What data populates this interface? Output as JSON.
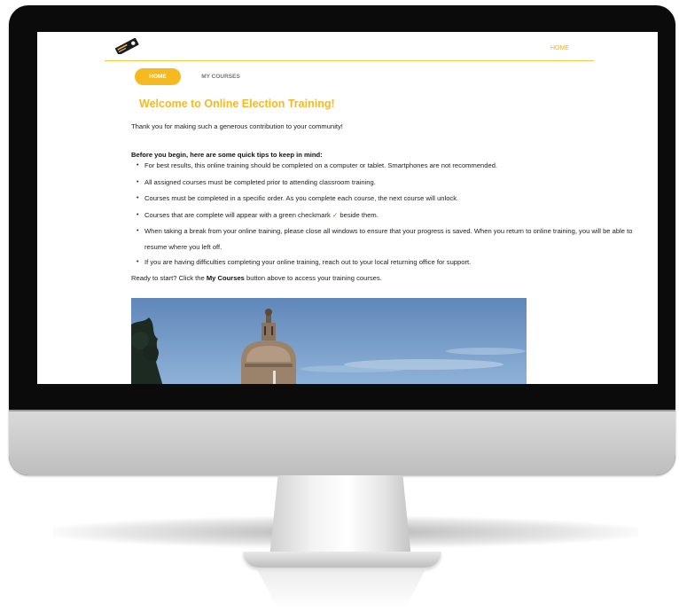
{
  "nav": {
    "home_label": "HOME"
  },
  "tabs": {
    "home_label": "HOME",
    "courses_label": "MY COURSES"
  },
  "welcome": {
    "title": "Welcome to Online Election Training!",
    "intro": "Thank you for making such a generous contribution to your community!"
  },
  "tips": {
    "heading": "Before you begin, here are some quick tips to keep in mind:",
    "items": [
      "For best results, this online training should be completed on a computer or tablet. Smartphones are not recommended.",
      "All assigned courses must be completed prior to attending classroom training.",
      "Courses must be completed in a specific order. As you complete each course, the next course will unlock.",
      "When taking a break from your online training, please close all windows to ensure that your progress is saved. When you return to online training, you will be able to resume where you left off.",
      "If you are having difficulties completing your online training, reach out to your local returning office for support."
    ],
    "checkmark_item": {
      "before": "Courses that are complete will appear with a green checkmark ",
      "check": "✓",
      "after": " beside them."
    }
  },
  "ready": {
    "before": "Ready to start? Click the ",
    "bold": "My Courses",
    "after": " button above to access your training courses."
  },
  "colors": {
    "accent": "#f5b922",
    "check": "#3a9d3a",
    "sky": "#7fa6cf"
  },
  "icons": {
    "logo": "brand-logo-icon"
  }
}
